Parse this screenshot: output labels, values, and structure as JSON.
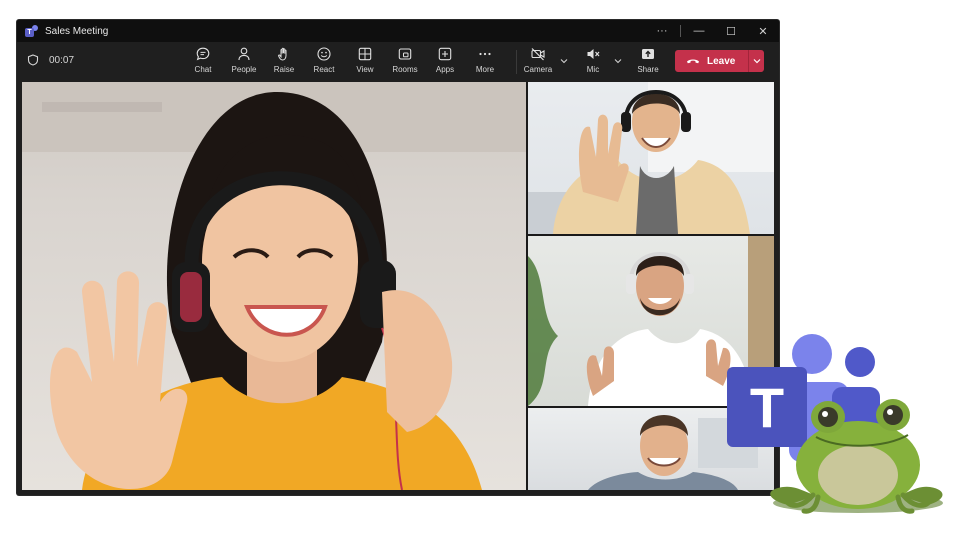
{
  "window": {
    "title": "Sales Meeting",
    "controls": [
      "···",
      "—",
      "☐",
      "✕"
    ]
  },
  "toolbar": {
    "timer": "00:07",
    "buttons": [
      {
        "label": "Chat",
        "icon": "chat-icon"
      },
      {
        "label": "People",
        "icon": "people-icon"
      },
      {
        "label": "Raise",
        "icon": "raise-hand-icon"
      },
      {
        "label": "React",
        "icon": "react-icon"
      },
      {
        "label": "View",
        "icon": "view-icon"
      },
      {
        "label": "Rooms",
        "icon": "rooms-icon"
      },
      {
        "label": "Apps",
        "icon": "apps-icon"
      },
      {
        "label": "More",
        "icon": "more-icon"
      },
      {
        "label": "Camera",
        "icon": "camera-off-icon"
      },
      {
        "label": "Mic",
        "icon": "mic-off-icon"
      },
      {
        "label": "Share",
        "icon": "share-icon"
      }
    ],
    "leave_label": "Leave"
  },
  "colors": {
    "leave": "#c4314b",
    "teams_purple": "#5b5fc7",
    "titlebar": "#0f0f0f",
    "toolbar": "#1f1f1f"
  },
  "participants": [
    {
      "tile": "main",
      "description_icon": "participant-video"
    },
    {
      "tile": "side-1",
      "description_icon": "participant-video"
    },
    {
      "tile": "side-2",
      "description_icon": "participant-video"
    },
    {
      "tile": "side-3",
      "description_icon": "participant-video"
    }
  ],
  "branding": {
    "logo_letter": "T"
  }
}
